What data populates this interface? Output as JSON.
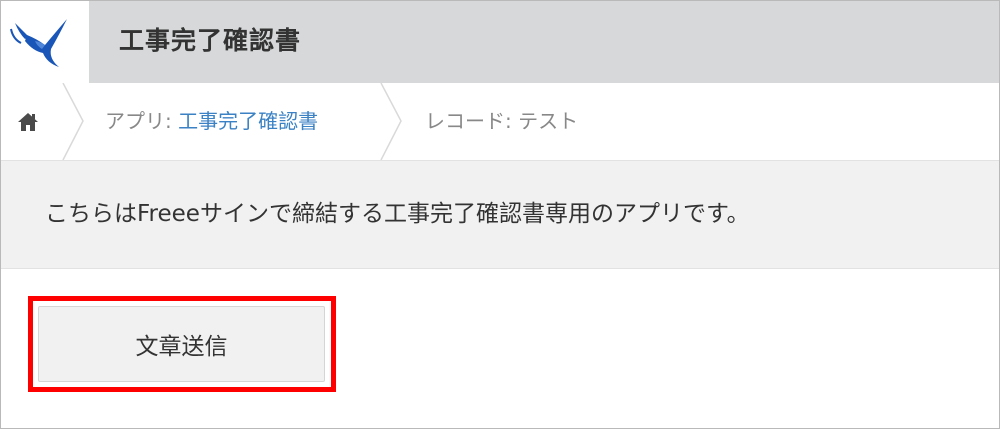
{
  "header": {
    "app_title": "工事完了確認書",
    "logo_icon": "swallow-bird-logo",
    "colors": {
      "header_bg": "#d6d8d9",
      "logo_blue": "#1a56b8"
    }
  },
  "breadcrumb": {
    "home_icon": "home-icon",
    "app_prefix": "アプリ: ",
    "app_link": "工事完了確認書",
    "record_label": "レコード: テスト",
    "colors": {
      "link": "#3b82c4",
      "text": "#888888"
    }
  },
  "description": {
    "text": "こちらはFreeeサインで締結する工事完了確認書専用のアプリです。"
  },
  "actions": {
    "send_label": "文章送信",
    "highlight_color": "#ff0000"
  }
}
